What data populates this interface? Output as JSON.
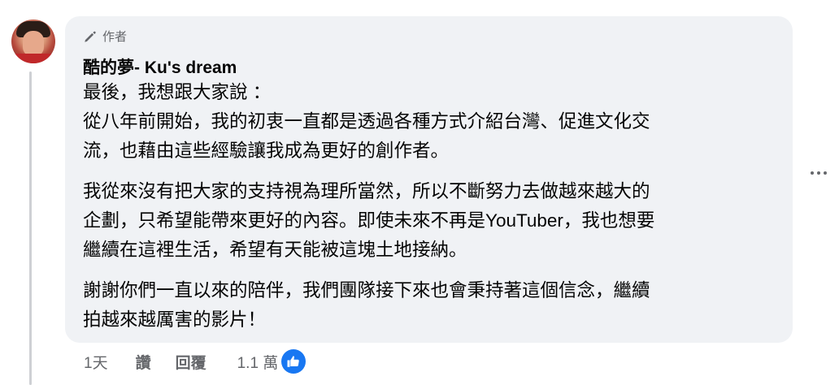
{
  "comment": {
    "author_badge": "作者",
    "author_name": "酷的夢- Ku's dream",
    "paragraphs": [
      [
        "最後，我想跟大家說 ：",
        "從八年前開始，我的初衷一直都是透過各種方式介紹台灣、促進文化交",
        "流，也藉由這些經驗讓我成為更好的創作者。"
      ],
      [
        "我從來沒有把大家的支持視為理所當然，所以不斷努力去做越來越大的",
        "企劃，只希望能帶來更好的內容。即使未來不再是YouTuber，我也想要",
        "繼續在這裡生活，希望有天能被這塊土地接納。"
      ],
      [
        "謝謝你們一直以來的陪伴，我們團隊接下來也會秉持著這個信念，繼續",
        "拍越來越厲害的影片！"
      ]
    ]
  },
  "actions": {
    "time": "1天",
    "like": "讚",
    "reply": "回覆",
    "reaction_count": "1.1 萬"
  },
  "colors": {
    "bubble_bg": "#f0f2f5",
    "secondary_text": "#65676b",
    "like_blue": "#1877f2"
  },
  "icons": [
    "pencil-icon",
    "more-icon",
    "like-reaction-icon"
  ]
}
